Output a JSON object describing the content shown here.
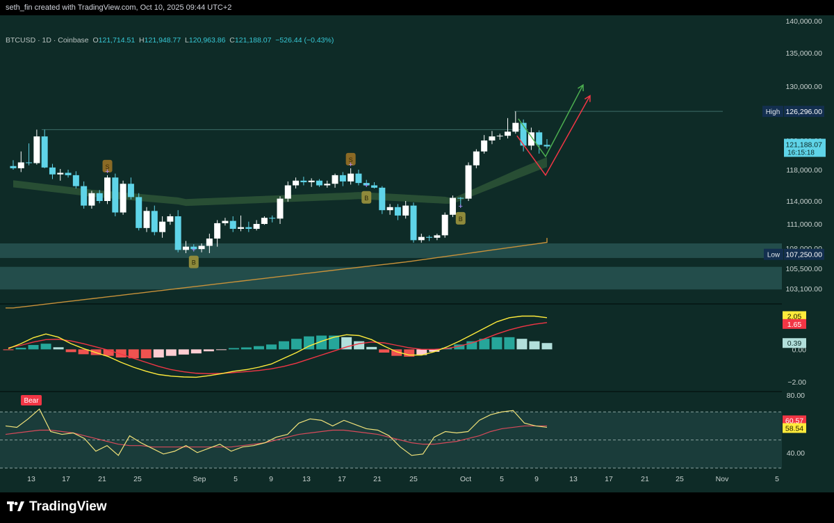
{
  "header": {
    "attribution": "seth_fin created with TradingView.com, Oct 10, 2025 09:44 UTC+2"
  },
  "footer": {
    "brand": "TradingView"
  },
  "legend": {
    "symbol": "BTCUSD · 1D · Coinbase",
    "open_label": "O",
    "open": "121,714.51",
    "high_label": "H",
    "high": "121,948.77",
    "low_label": "L",
    "low": "120,963.86",
    "close_label": "C",
    "close": "121,188.07",
    "change": "−526.44 (−0.43%)"
  },
  "colors": {
    "background": "#0e2b27",
    "up_candle": "#ffffff",
    "down_candle": "#5fd4e8",
    "ema_line": "#c8923a",
    "macd_line": "#ffeb3b",
    "signal_line": "#f23645",
    "rsi_line": "#f2e37a",
    "rsi_ma_line": "#d84a5a",
    "arrow_up": "#4caf50",
    "arrow_down": "#f23645"
  },
  "chart_data": [
    {
      "type": "candlestick",
      "name": "BTCUSD price",
      "y_axis_ticks": [
        "140,000.00",
        "135,000.00",
        "130,000.00",
        "122,000.00",
        "118,000.00",
        "114,000.00",
        "111,000.00",
        "108,000.00",
        "105,500.00",
        "103,100.00"
      ],
      "y_tick_values": [
        140000,
        135000,
        130000,
        122000,
        118000,
        114000,
        111000,
        108000,
        105500,
        103100
      ],
      "x_axis_ticks": [
        "13",
        "17",
        "21",
        "25",
        "Sep",
        "5",
        "9",
        "13",
        "17",
        "21",
        "25",
        "Oct",
        "5",
        "9",
        "13",
        "17",
        "21",
        "25",
        "Nov",
        "5"
      ],
      "high_marker": {
        "label": "High",
        "value": "126,296.00"
      },
      "low_marker": {
        "label": "Low",
        "value": "107,250.00"
      },
      "last_price": {
        "value": "121,188.07",
        "countdown": "16:15:18"
      },
      "candles": [
        {
          "o": 118500,
          "h": 119300,
          "l": 118000,
          "c": 118200
        },
        {
          "o": 118200,
          "h": 120500,
          "l": 117700,
          "c": 119000
        },
        {
          "o": 119000,
          "h": 121600,
          "l": 118600,
          "c": 118900
        },
        {
          "o": 118900,
          "h": 123600,
          "l": 118700,
          "c": 122600
        },
        {
          "o": 122600,
          "h": 123600,
          "l": 118200,
          "c": 118300
        },
        {
          "o": 118300,
          "h": 118800,
          "l": 116800,
          "c": 117400
        },
        {
          "o": 117400,
          "h": 118100,
          "l": 116600,
          "c": 117600
        },
        {
          "o": 117600,
          "h": 118000,
          "l": 117000,
          "c": 117300
        },
        {
          "o": 117300,
          "h": 117800,
          "l": 115600,
          "c": 115900
        },
        {
          "o": 115900,
          "h": 116500,
          "l": 113000,
          "c": 113400
        },
        {
          "o": 113400,
          "h": 115300,
          "l": 113000,
          "c": 115000
        },
        {
          "o": 115000,
          "h": 115400,
          "l": 113700,
          "c": 114000
        },
        {
          "o": 114000,
          "h": 117300,
          "l": 113600,
          "c": 117000
        },
        {
          "o": 117000,
          "h": 117500,
          "l": 112000,
          "c": 112500
        },
        {
          "o": 112500,
          "h": 116600,
          "l": 112200,
          "c": 116200
        },
        {
          "o": 116200,
          "h": 117000,
          "l": 114200,
          "c": 114500
        },
        {
          "o": 114500,
          "h": 115000,
          "l": 110200,
          "c": 110500
        },
        {
          "o": 110500,
          "h": 113200,
          "l": 110000,
          "c": 112700
        },
        {
          "o": 112700,
          "h": 113400,
          "l": 109600,
          "c": 110000
        },
        {
          "o": 110000,
          "h": 112000,
          "l": 109300,
          "c": 111300
        },
        {
          "o": 111300,
          "h": 112300,
          "l": 110900,
          "c": 112000
        },
        {
          "o": 112000,
          "h": 112800,
          "l": 107500,
          "c": 107800
        },
        {
          "o": 107800,
          "h": 108900,
          "l": 107400,
          "c": 108200
        },
        {
          "o": 108200,
          "h": 108500,
          "l": 107600,
          "c": 107900
        },
        {
          "o": 107900,
          "h": 108600,
          "l": 107500,
          "c": 108300
        },
        {
          "o": 108300,
          "h": 109800,
          "l": 107400,
          "c": 109200
        },
        {
          "o": 109200,
          "h": 111500,
          "l": 108200,
          "c": 111100
        },
        {
          "o": 111100,
          "h": 111800,
          "l": 110800,
          "c": 111400
        },
        {
          "o": 111400,
          "h": 112000,
          "l": 110000,
          "c": 110400
        },
        {
          "o": 110400,
          "h": 112100,
          "l": 110100,
          "c": 110600
        },
        {
          "o": 110600,
          "h": 111300,
          "l": 110000,
          "c": 110400
        },
        {
          "o": 110400,
          "h": 111500,
          "l": 110200,
          "c": 111000
        },
        {
          "o": 111000,
          "h": 112000,
          "l": 110900,
          "c": 111800
        },
        {
          "o": 111800,
          "h": 112100,
          "l": 111200,
          "c": 111700
        },
        {
          "o": 111700,
          "h": 114600,
          "l": 111000,
          "c": 114300
        },
        {
          "o": 114300,
          "h": 116500,
          "l": 113900,
          "c": 116000
        },
        {
          "o": 116000,
          "h": 117000,
          "l": 115600,
          "c": 116600
        },
        {
          "o": 116600,
          "h": 117100,
          "l": 116000,
          "c": 116400
        },
        {
          "o": 116400,
          "h": 116900,
          "l": 115800,
          "c": 116600
        },
        {
          "o": 116600,
          "h": 116800,
          "l": 115800,
          "c": 116000
        },
        {
          "o": 116000,
          "h": 116600,
          "l": 115700,
          "c": 116200
        },
        {
          "o": 116200,
          "h": 117500,
          "l": 115700,
          "c": 117300
        },
        {
          "o": 117300,
          "h": 117700,
          "l": 115900,
          "c": 116500
        },
        {
          "o": 116500,
          "h": 118200,
          "l": 116100,
          "c": 117500
        },
        {
          "o": 117500,
          "h": 118000,
          "l": 116000,
          "c": 116300
        },
        {
          "o": 116300,
          "h": 116700,
          "l": 115800,
          "c": 116000
        },
        {
          "o": 116000,
          "h": 116400,
          "l": 115600,
          "c": 115700
        },
        {
          "o": 115700,
          "h": 115900,
          "l": 112300,
          "c": 112800
        },
        {
          "o": 112800,
          "h": 113600,
          "l": 112200,
          "c": 113200
        },
        {
          "o": 113200,
          "h": 113600,
          "l": 111500,
          "c": 112100
        },
        {
          "o": 112100,
          "h": 114000,
          "l": 111700,
          "c": 113400
        },
        {
          "o": 113400,
          "h": 113800,
          "l": 108700,
          "c": 109000
        },
        {
          "o": 109000,
          "h": 109800,
          "l": 108700,
          "c": 109400
        },
        {
          "o": 109400,
          "h": 109600,
          "l": 108900,
          "c": 109300
        },
        {
          "o": 109300,
          "h": 109800,
          "l": 109000,
          "c": 109600
        },
        {
          "o": 109600,
          "h": 112500,
          "l": 109300,
          "c": 112200
        },
        {
          "o": 112200,
          "h": 114700,
          "l": 111900,
          "c": 114400
        },
        {
          "o": 114400,
          "h": 114500,
          "l": 113100,
          "c": 114300
        },
        {
          "o": 114300,
          "h": 119000,
          "l": 114000,
          "c": 118600
        },
        {
          "o": 118600,
          "h": 120800,
          "l": 118200,
          "c": 120500
        },
        {
          "o": 120500,
          "h": 122800,
          "l": 120200,
          "c": 122000
        },
        {
          "o": 122000,
          "h": 123400,
          "l": 121500,
          "c": 122600
        },
        {
          "o": 122600,
          "h": 123000,
          "l": 122100,
          "c": 122700
        },
        {
          "o": 122700,
          "h": 125300,
          "l": 122300,
          "c": 123300
        },
        {
          "o": 123300,
          "h": 126296,
          "l": 123000,
          "c": 124600
        },
        {
          "o": 124600,
          "h": 125100,
          "l": 120500,
          "c": 121300
        },
        {
          "o": 121300,
          "h": 123900,
          "l": 120700,
          "c": 123200
        },
        {
          "o": 123200,
          "h": 123500,
          "l": 120200,
          "c": 121400
        },
        {
          "o": 121400,
          "h": 122200,
          "l": 120900,
          "c": 121188
        }
      ],
      "signals": [
        {
          "label": "S",
          "candle": 12
        },
        {
          "label": "B",
          "candle": 23
        },
        {
          "label": "S",
          "candle": 43
        },
        {
          "label": "B",
          "candle": 45
        },
        {
          "label": "B",
          "candle": 57
        }
      ]
    },
    {
      "type": "line",
      "name": "MACD",
      "y_axis_ticks": [
        "0.00",
        "−2.00"
      ],
      "series": [
        {
          "name": "",
          "role": "macd",
          "values": [
            0.05,
            0.35,
            0.72,
            0.95,
            0.75,
            0.35,
            0.05,
            -0.2,
            -0.45,
            -0.8,
            -1.1,
            -1.35,
            -1.55,
            -1.65,
            -1.7,
            -1.72,
            -1.62,
            -1.5,
            -1.35,
            -1.25,
            -1.1,
            -0.9,
            -0.55,
            -0.2,
            0.2,
            0.5,
            0.75,
            0.9,
            0.85,
            0.6,
            0.2,
            -0.15,
            -0.35,
            -0.35,
            -0.15,
            0.15,
            0.5,
            0.9,
            1.3,
            1.7,
            1.95,
            2.05,
            2.05,
            1.95
          ]
        },
        {
          "name": "",
          "role": "signal",
          "values": [
            0.1,
            0.25,
            0.45,
            0.6,
            0.62,
            0.52,
            0.35,
            0.15,
            -0.05,
            -0.3,
            -0.55,
            -0.8,
            -1.05,
            -1.25,
            -1.38,
            -1.47,
            -1.5,
            -1.48,
            -1.43,
            -1.37,
            -1.3,
            -1.2,
            -1.05,
            -0.85,
            -0.6,
            -0.35,
            -0.1,
            0.15,
            0.35,
            0.45,
            0.4,
            0.25,
            0.1,
            0,
            0,
            0.05,
            0.2,
            0.4,
            0.65,
            0.95,
            1.2,
            1.4,
            1.55,
            1.65
          ]
        },
        {
          "name": "",
          "role": "histogram",
          "values": [
            -0.05,
            0.1,
            0.27,
            0.35,
            0.13,
            -0.17,
            -0.3,
            -0.35,
            -0.4,
            -0.5,
            -0.55,
            -0.55,
            -0.5,
            -0.4,
            -0.32,
            -0.25,
            -0.12,
            -0.02,
            0.08,
            0.12,
            0.2,
            0.3,
            0.5,
            0.65,
            0.8,
            0.85,
            0.85,
            0.75,
            0.5,
            0.15,
            -0.2,
            -0.4,
            -0.45,
            -0.35,
            -0.15,
            0.1,
            0.3,
            0.5,
            0.65,
            0.75,
            0.75,
            0.65,
            0.5,
            0.39
          ]
        }
      ],
      "labels": {
        "macd": "2.05",
        "signal": "1.65",
        "histogram": "0.39"
      }
    },
    {
      "type": "line",
      "name": "RSI",
      "y_axis_ticks": [
        "80.00",
        "40.00"
      ],
      "badge": "Bear",
      "series": [
        {
          "name": "",
          "role": "rsi",
          "values": [
            60,
            59,
            65,
            72,
            56,
            54,
            55,
            51,
            42,
            46,
            39,
            53,
            48,
            44,
            40,
            42,
            46,
            41,
            44,
            47,
            42,
            45,
            46,
            48,
            52,
            54,
            62,
            65,
            64,
            60,
            64,
            61,
            58,
            57,
            53,
            45,
            39,
            40,
            52,
            56,
            55,
            56,
            64,
            68,
            70,
            71,
            62,
            60,
            59
          ]
        },
        {
          "name": "",
          "role": "rsi_ma",
          "values": [
            54,
            55,
            56,
            57,
            57,
            56,
            55,
            53,
            51,
            49,
            47,
            46,
            46,
            45,
            45,
            45,
            45,
            45,
            45,
            45,
            45,
            46,
            47,
            48,
            50,
            52,
            54,
            55,
            56,
            57,
            57,
            56,
            55,
            54,
            52,
            50,
            48,
            47,
            47,
            48,
            49,
            51,
            53,
            56,
            58,
            59,
            60,
            60,
            60
          ]
        }
      ],
      "labels": {
        "rsi": "60.57",
        "rsi_ma": "58.54"
      }
    }
  ]
}
